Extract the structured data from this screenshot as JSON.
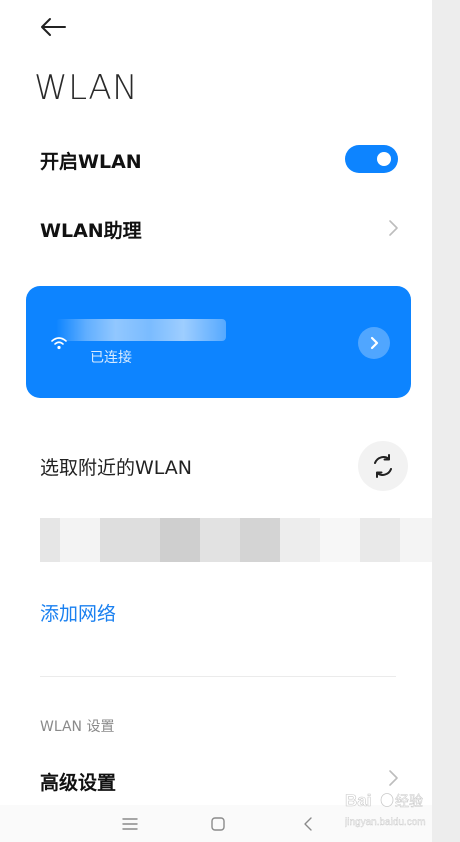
{
  "header": {
    "title": "WLAN"
  },
  "toggle_row": {
    "label": "开启WLAN",
    "enabled": true
  },
  "assistant_row": {
    "label": "WLAN助理"
  },
  "connected_card": {
    "status": "已连接",
    "ssid": ""
  },
  "nearby": {
    "label": "选取附近的WLAN"
  },
  "add_network": {
    "label": "添加网络"
  },
  "settings": {
    "section_label": "WLAN 设置",
    "advanced_label": "高级设置"
  },
  "watermark": {
    "brand": "Bai",
    "brand_sub": "经验",
    "url": "jingyan.baidu.com"
  },
  "colors": {
    "accent": "#0d84ff",
    "link": "#1a80f0"
  },
  "icons": [
    "back-arrow-icon",
    "chevron-right-icon",
    "wifi-icon",
    "refresh-icon",
    "menu-icon",
    "home-icon",
    "back-icon"
  ]
}
